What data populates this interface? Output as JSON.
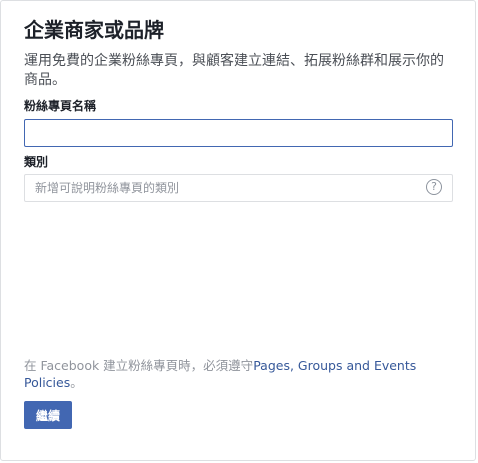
{
  "header": {
    "title": "企業商家或品牌",
    "description": "運用免費的企業粉絲專頁，與顧客建立連結、拓展粉絲群和展示你的商品。"
  },
  "form": {
    "page_name_label": "粉絲專頁名稱",
    "page_name_value": "",
    "category_label": "類別",
    "category_placeholder": "新增可說明粉絲專頁的類別",
    "help_icon_glyph": "?"
  },
  "policy": {
    "prefix": "在 Facebook 建立粉絲專頁時，必須遵守",
    "link_text": "Pages, Groups and Events Policies",
    "suffix": "。"
  },
  "actions": {
    "continue_label": "繼續"
  },
  "colors": {
    "primary": "#4267b2",
    "link": "#365899",
    "border": "#dddfe2",
    "muted_text": "#90949c"
  }
}
